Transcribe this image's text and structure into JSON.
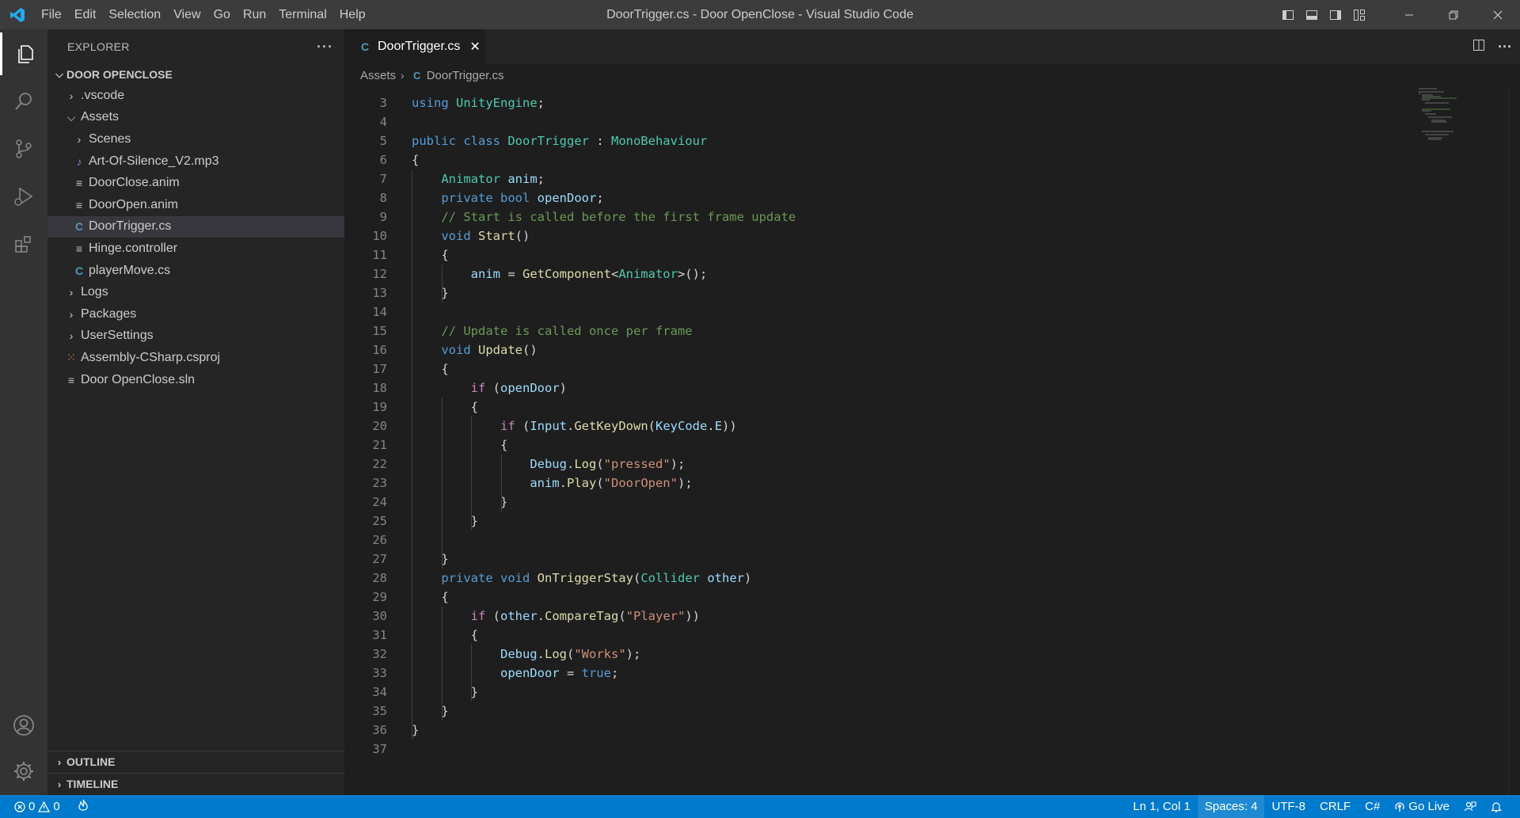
{
  "window": {
    "title": "DoorTrigger.cs - Door OpenClose - Visual Studio Code"
  },
  "menu": [
    "File",
    "Edit",
    "Selection",
    "View",
    "Go",
    "Run",
    "Terminal",
    "Help"
  ],
  "sidebar": {
    "header": "EXPLORER",
    "more": "···",
    "workspace": "DOOR OPENCLOSE",
    "tree": [
      {
        "label": ".vscode",
        "kind": "folder",
        "indent": 0
      },
      {
        "label": "Assets",
        "kind": "folder-open",
        "indent": 0
      },
      {
        "label": "Scenes",
        "kind": "folder",
        "indent": 1
      },
      {
        "label": "Art-Of-Silence_V2.mp3",
        "kind": "audio",
        "indent": 1
      },
      {
        "label": "DoorClose.anim",
        "kind": "text",
        "indent": 1
      },
      {
        "label": "DoorOpen.anim",
        "kind": "text",
        "indent": 1
      },
      {
        "label": "DoorTrigger.cs",
        "kind": "csharp",
        "indent": 1
      },
      {
        "label": "Hinge.controller",
        "kind": "text",
        "indent": 1
      },
      {
        "label": "playerMove.cs",
        "kind": "csharp",
        "indent": 1
      },
      {
        "label": "Logs",
        "kind": "folder",
        "indent": 0
      },
      {
        "label": "Packages",
        "kind": "folder",
        "indent": 0
      },
      {
        "label": "UserSettings",
        "kind": "folder",
        "indent": 0
      },
      {
        "label": "Assembly-CSharp.csproj",
        "kind": "rss",
        "indent": 0
      },
      {
        "label": "Door OpenClose.sln",
        "kind": "text",
        "indent": 0
      }
    ],
    "outline": "OUTLINE",
    "timeline": "TIMELINE"
  },
  "editor": {
    "tab": "DoorTrigger.cs",
    "breadcrumb": [
      "Assets",
      "DoorTrigger.cs"
    ],
    "lines": [
      {
        "n": "3",
        "t": [
          [
            "kw",
            "using"
          ],
          [
            "pl",
            " "
          ],
          [
            "ty",
            "UnityEngine"
          ],
          [
            "pl",
            ";"
          ]
        ]
      },
      {
        "n": "4",
        "t": []
      },
      {
        "n": "5",
        "t": [
          [
            "kw",
            "public class"
          ],
          [
            "pl",
            " "
          ],
          [
            "ty",
            "DoorTrigger"
          ],
          [
            "pl",
            " : "
          ],
          [
            "ty",
            "MonoBehaviour"
          ]
        ]
      },
      {
        "n": "6",
        "t": [
          [
            "pl",
            "{"
          ]
        ]
      },
      {
        "n": "7",
        "t": [
          [
            "pl",
            "    "
          ],
          [
            "ty",
            "Animator"
          ],
          [
            "pl",
            " "
          ],
          [
            "var",
            "anim"
          ],
          [
            "pl",
            ";"
          ]
        ]
      },
      {
        "n": "8",
        "t": [
          [
            "pl",
            "    "
          ],
          [
            "kw",
            "private bool"
          ],
          [
            "pl",
            " "
          ],
          [
            "var",
            "openDoor"
          ],
          [
            "pl",
            ";"
          ]
        ]
      },
      {
        "n": "9",
        "t": [
          [
            "pl",
            "    "
          ],
          [
            "cm",
            "// Start is called before the first frame update"
          ]
        ]
      },
      {
        "n": "10",
        "t": [
          [
            "pl",
            "    "
          ],
          [
            "kw",
            "void"
          ],
          [
            "pl",
            " "
          ],
          [
            "fn",
            "Start"
          ],
          [
            "pl",
            "()"
          ]
        ]
      },
      {
        "n": "11",
        "t": [
          [
            "pl",
            "    {"
          ]
        ]
      },
      {
        "n": "12",
        "t": [
          [
            "pl",
            "        "
          ],
          [
            "var",
            "anim"
          ],
          [
            "pl",
            " = "
          ],
          [
            "fn",
            "GetComponent"
          ],
          [
            "pl",
            "<"
          ],
          [
            "ty",
            "Animator"
          ],
          [
            "pl",
            ">();"
          ]
        ]
      },
      {
        "n": "13",
        "t": [
          [
            "pl",
            "    }"
          ]
        ]
      },
      {
        "n": "14",
        "t": []
      },
      {
        "n": "15",
        "t": [
          [
            "pl",
            "    "
          ],
          [
            "cm",
            "// Update is called once per frame"
          ]
        ]
      },
      {
        "n": "16",
        "t": [
          [
            "pl",
            "    "
          ],
          [
            "kw",
            "void"
          ],
          [
            "pl",
            " "
          ],
          [
            "fn",
            "Update"
          ],
          [
            "pl",
            "()"
          ]
        ]
      },
      {
        "n": "17",
        "t": [
          [
            "pl",
            "    {"
          ]
        ]
      },
      {
        "n": "18",
        "t": [
          [
            "pl",
            "        "
          ],
          [
            "ctl",
            "if"
          ],
          [
            "pl",
            " ("
          ],
          [
            "var",
            "openDoor"
          ],
          [
            "pl",
            ")"
          ]
        ]
      },
      {
        "n": "19",
        "t": [
          [
            "pl",
            "        {"
          ]
        ]
      },
      {
        "n": "20",
        "t": [
          [
            "pl",
            "            "
          ],
          [
            "ctl",
            "if"
          ],
          [
            "pl",
            " ("
          ],
          [
            "var",
            "Input"
          ],
          [
            "pl",
            "."
          ],
          [
            "fn",
            "GetKeyDown"
          ],
          [
            "pl",
            "("
          ],
          [
            "var",
            "KeyCode"
          ],
          [
            "pl",
            "."
          ],
          [
            "var",
            "E"
          ],
          [
            "pl",
            "))"
          ]
        ]
      },
      {
        "n": "21",
        "t": [
          [
            "pl",
            "            {"
          ]
        ]
      },
      {
        "n": "22",
        "t": [
          [
            "pl",
            "                "
          ],
          [
            "var",
            "Debug"
          ],
          [
            "pl",
            "."
          ],
          [
            "fn",
            "Log"
          ],
          [
            "pl",
            "("
          ],
          [
            "str",
            "\"pressed\""
          ],
          [
            "pl",
            ");"
          ]
        ]
      },
      {
        "n": "23",
        "t": [
          [
            "pl",
            "                "
          ],
          [
            "var",
            "anim"
          ],
          [
            "pl",
            "."
          ],
          [
            "fn",
            "Play"
          ],
          [
            "pl",
            "("
          ],
          [
            "str",
            "\"DoorOpen\""
          ],
          [
            "pl",
            ");"
          ]
        ]
      },
      {
        "n": "24",
        "t": [
          [
            "pl",
            "            }"
          ]
        ]
      },
      {
        "n": "25",
        "t": [
          [
            "pl",
            "        }"
          ]
        ]
      },
      {
        "n": "26",
        "t": []
      },
      {
        "n": "27",
        "t": [
          [
            "pl",
            "    }"
          ]
        ]
      },
      {
        "n": "28",
        "t": [
          [
            "pl",
            "    "
          ],
          [
            "kw",
            "private void"
          ],
          [
            "pl",
            " "
          ],
          [
            "fn",
            "OnTriggerStay"
          ],
          [
            "pl",
            "("
          ],
          [
            "ty",
            "Collider"
          ],
          [
            "pl",
            " "
          ],
          [
            "var",
            "other"
          ],
          [
            "pl",
            ")"
          ]
        ]
      },
      {
        "n": "29",
        "t": [
          [
            "pl",
            "    {"
          ]
        ]
      },
      {
        "n": "30",
        "t": [
          [
            "pl",
            "        "
          ],
          [
            "ctl",
            "if"
          ],
          [
            "pl",
            " ("
          ],
          [
            "var",
            "other"
          ],
          [
            "pl",
            "."
          ],
          [
            "fn",
            "CompareTag"
          ],
          [
            "pl",
            "("
          ],
          [
            "str",
            "\"Player\""
          ],
          [
            "pl",
            "))"
          ]
        ]
      },
      {
        "n": "31",
        "t": [
          [
            "pl",
            "        {"
          ]
        ]
      },
      {
        "n": "32",
        "t": [
          [
            "pl",
            "            "
          ],
          [
            "var",
            "Debug"
          ],
          [
            "pl",
            "."
          ],
          [
            "fn",
            "Log"
          ],
          [
            "pl",
            "("
          ],
          [
            "str",
            "\"Works\""
          ],
          [
            "pl",
            ");"
          ]
        ]
      },
      {
        "n": "33",
        "t": [
          [
            "pl",
            "            "
          ],
          [
            "var",
            "openDoor"
          ],
          [
            "pl",
            " = "
          ],
          [
            "kw",
            "true"
          ],
          [
            "pl",
            ";"
          ]
        ]
      },
      {
        "n": "34",
        "t": [
          [
            "pl",
            "        }"
          ]
        ]
      },
      {
        "n": "35",
        "t": [
          [
            "pl",
            "    }"
          ]
        ]
      },
      {
        "n": "36",
        "t": [
          [
            "pl",
            "}"
          ]
        ]
      },
      {
        "n": "37",
        "t": []
      }
    ]
  },
  "statusbar": {
    "errors": "0",
    "warnings": "0",
    "position": "Ln 1, Col 1",
    "spaces": "Spaces: 4",
    "encoding": "UTF-8",
    "eol": "CRLF",
    "language": "C#",
    "golive": "Go Live"
  },
  "colors": {
    "accent": "#007acc",
    "csharp_icon": "#519aba",
    "audio_icon": "#a074c4",
    "rss_icon": "#e37933"
  }
}
